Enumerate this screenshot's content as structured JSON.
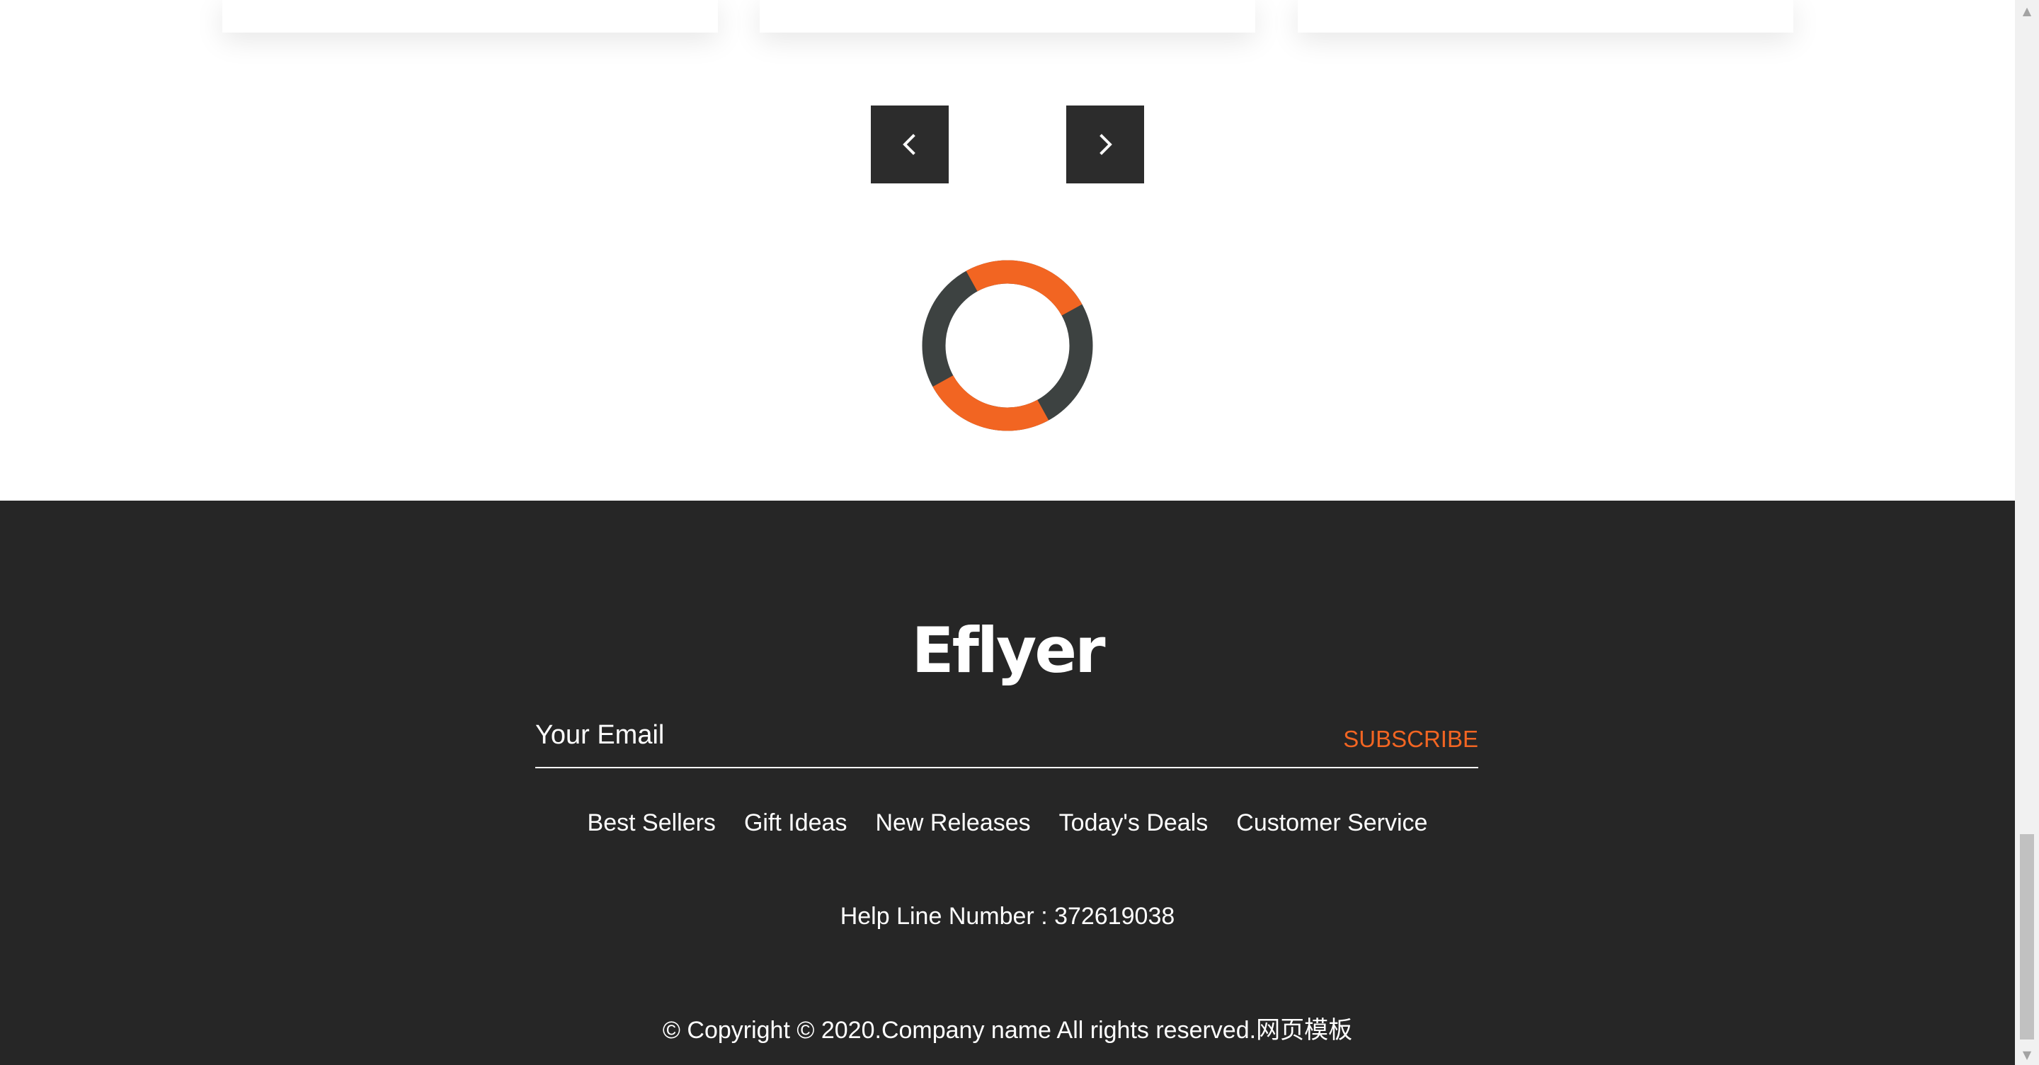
{
  "carousel": {
    "prev_icon": "chevron-left-icon",
    "next_icon": "chevron-right-icon"
  },
  "loader": {
    "accent_color": "#f26522",
    "track_color": "#3d4241"
  },
  "footer": {
    "logo": "Eflyer",
    "email_placeholder": "Your Email",
    "subscribe_label": "SUBSCRIBE",
    "links": [
      "Best Sellers",
      "Gift Ideas",
      "New Releases",
      "Today's Deals",
      "Customer Service"
    ],
    "helpline": "Help Line Number : 372619038",
    "copyright": "© Copyright © 2020.Company name All rights reserved.网页模板",
    "background_color": "#262626",
    "accent_color": "#f26522"
  },
  "scrollbar": {
    "up_arrow": "▲",
    "down_arrow": "▼"
  }
}
